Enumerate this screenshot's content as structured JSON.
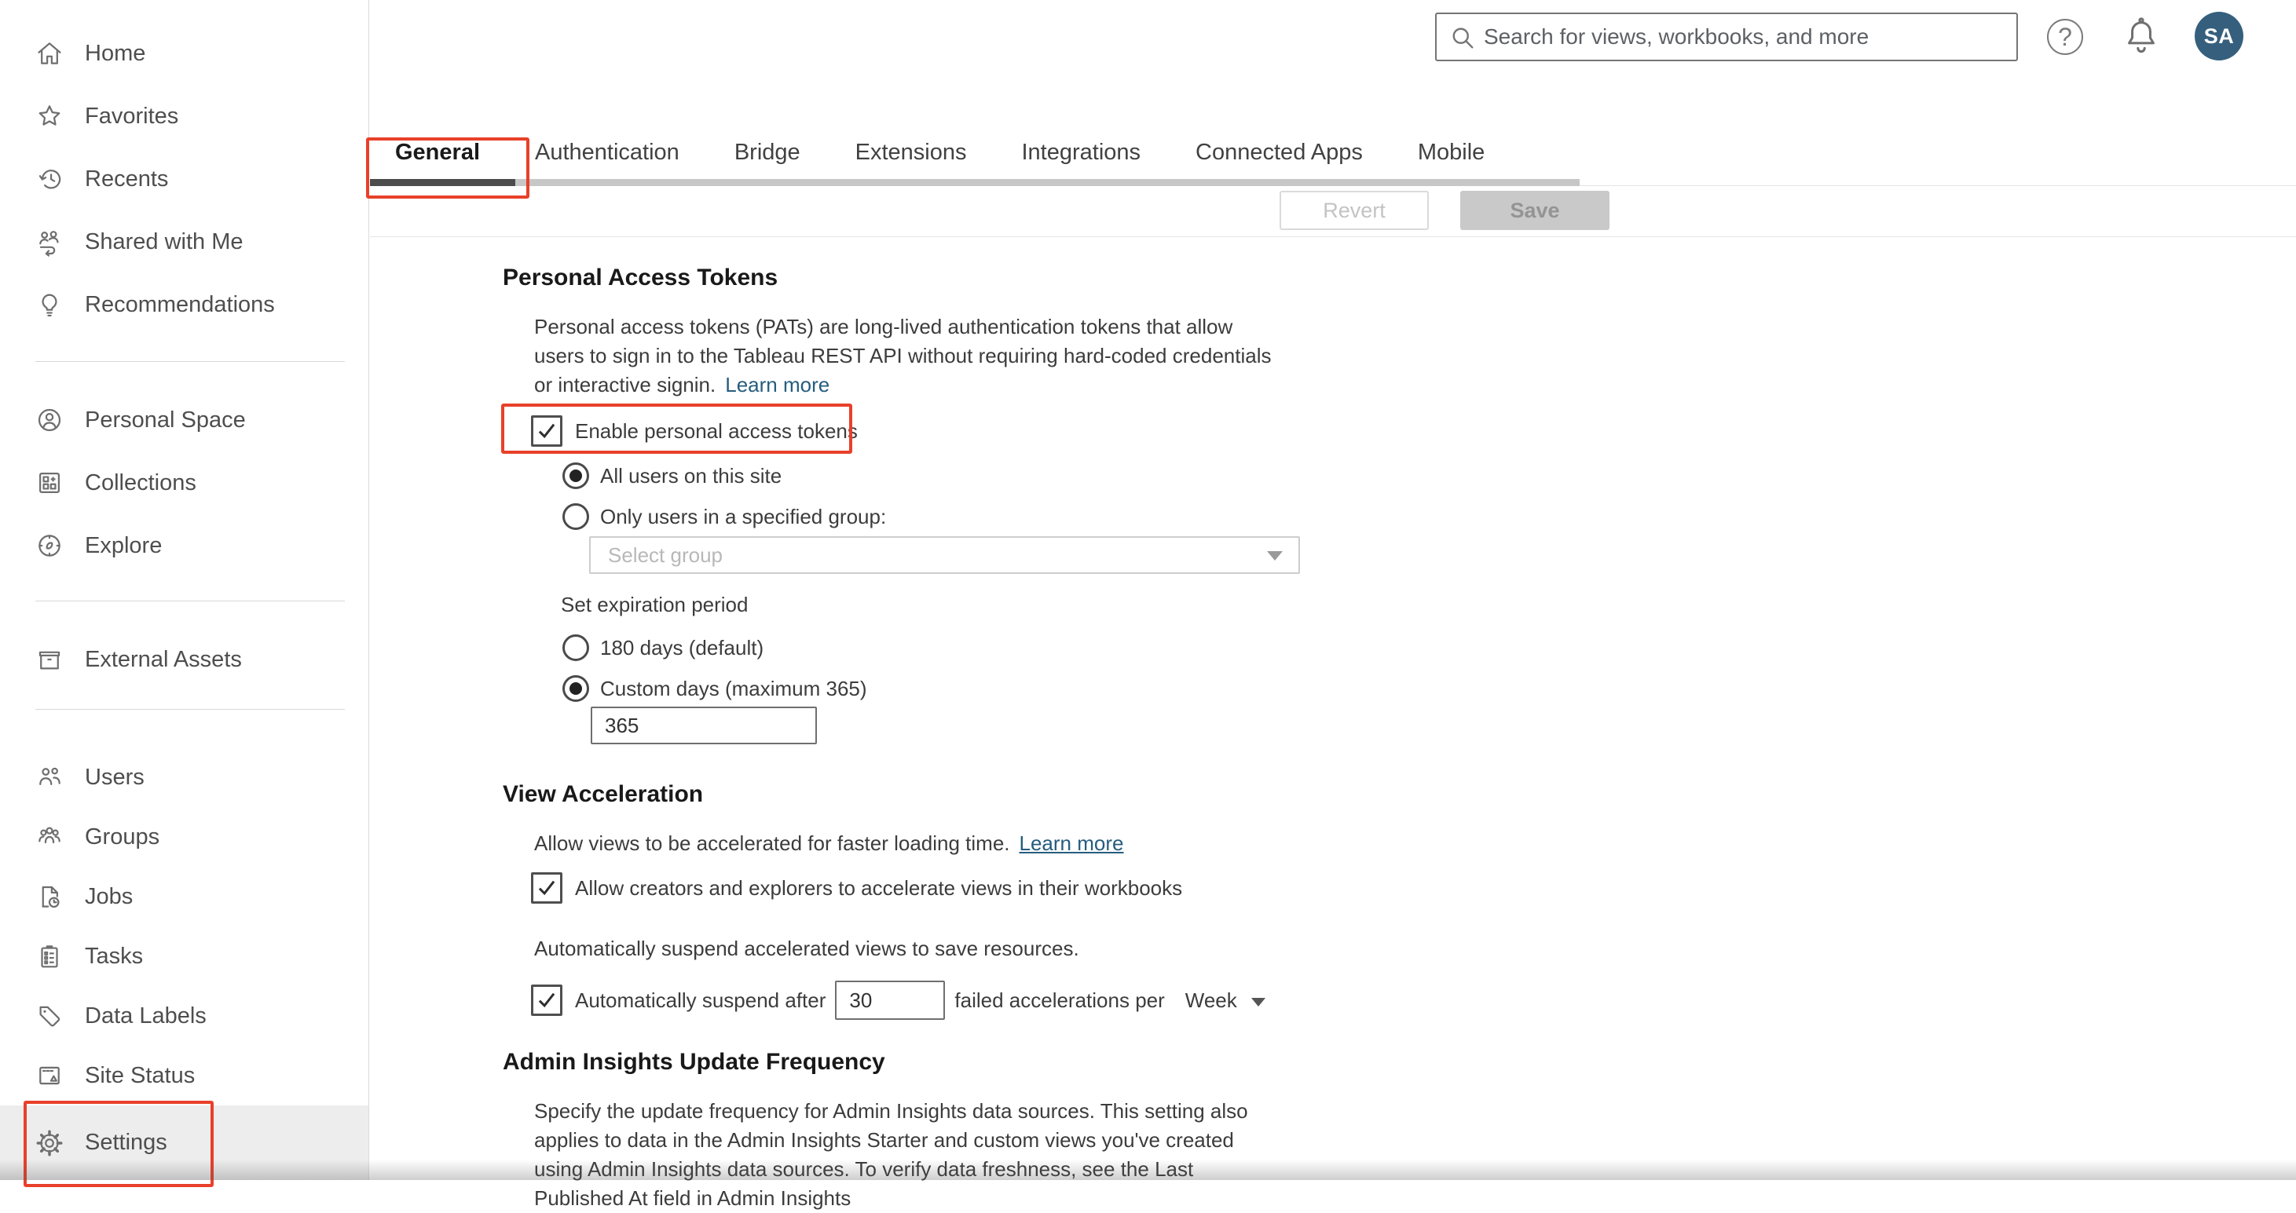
{
  "topbar": {
    "search_placeholder": "Search for views, workbooks, and more",
    "icons": [
      "search-icon",
      "help-icon",
      "notifications-icon"
    ],
    "avatar_initials": "SA"
  },
  "tabs": {
    "items": [
      "General",
      "Authentication",
      "Bridge",
      "Extensions",
      "Integrations",
      "Connected Apps",
      "Mobile"
    ],
    "active_tab": "General",
    "revert_label": "Revert",
    "save_label": "Save"
  },
  "sidebar": {
    "selected": "Settings",
    "items": [
      {
        "label": "Home",
        "icon": "home-icon"
      },
      {
        "label": "Favorites",
        "icon": "star-icon"
      },
      {
        "label": "Recents",
        "icon": "history-icon"
      },
      {
        "label": "Shared with Me",
        "icon": "shared-with-me-icon"
      },
      {
        "label": "Recommendations",
        "icon": "lightbulb-icon"
      },
      {
        "label": "Personal Space",
        "icon": "person-circle-icon"
      },
      {
        "label": "Collections",
        "icon": "collections-icon"
      },
      {
        "label": "Explore",
        "icon": "compass-icon"
      },
      {
        "label": "External Assets",
        "icon": "archive-box-icon"
      },
      {
        "label": "Users",
        "icon": "users-icon"
      },
      {
        "label": "Groups",
        "icon": "groups-icon"
      },
      {
        "label": "Jobs",
        "icon": "document-clock-icon"
      },
      {
        "label": "Tasks",
        "icon": "clipboard-list-icon"
      },
      {
        "label": "Data Labels",
        "icon": "tag-icon"
      },
      {
        "label": "Site Status",
        "icon": "site-status-icon"
      },
      {
        "label": "Settings",
        "icon": "gear-icon"
      }
    ]
  },
  "content": {
    "pat": {
      "heading": "Personal Access Tokens",
      "description": "Personal access tokens (PATs) are long-lived authentication tokens that allow users to sign in to the Tableau REST API without requiring hard-coded credentials or interactive signin.",
      "learn_more": "Learn more",
      "enable_checkbox_label": "Enable personal access tokens",
      "enable_checked": true,
      "radio_all_users": "All users on this site",
      "radio_specified_group": "Only users in a specified group:",
      "group_select_placeholder": "Select group",
      "expiration_label": "Set expiration period",
      "radio_180_days": "180 days (default)",
      "radio_custom_days": "Custom days (maximum 365)",
      "custom_days_value": "365"
    },
    "view_acceleration": {
      "heading": "View Acceleration",
      "description": "Allow views to be accelerated for faster loading time.",
      "learn_more": "Learn more",
      "allow_checkbox_label": "Allow creators and explorers to accelerate views in their workbooks",
      "allow_checked": true,
      "suspend_description": "Automatically suspend accelerated views to save resources.",
      "suspend_checkbox_label": "Automatically suspend after",
      "suspend_checked": true,
      "suspend_value": "30",
      "suspend_suffix": "failed accelerations per",
      "period_selected": "Week"
    },
    "admin_insights": {
      "heading": "Admin Insights Update Frequency",
      "description": "Specify the update frequency for Admin Insights data sources. This setting also applies to data in the Admin Insights Starter and custom views you've created using Admin Insights data sources. To verify data freshness, see the Last Published At field in Admin Insights"
    }
  },
  "colors": {
    "annotation_red": "#e8402a",
    "link_blue": "#255d7e",
    "avatar_bg": "#355f7d",
    "active_tab_underline": "#4c4c4c",
    "selected_row_bg": "#ededed"
  }
}
